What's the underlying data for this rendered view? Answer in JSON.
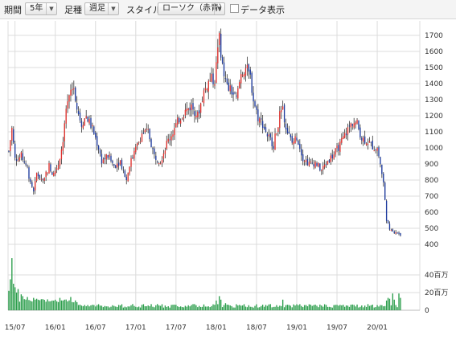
{
  "toolbar": {
    "period_label": "期間",
    "period_value": "5年",
    "interval_label": "足種",
    "interval_value": "週足",
    "style_label": "スタイル",
    "style_value": "ローソク（赤青）",
    "data_toggle_label": "データ表示"
  },
  "colors": {
    "up_candle": "#e0302c",
    "down_candle": "#1d3a9e",
    "volume": "#2a9d4a",
    "grid": "#dcdcdc",
    "wick": "#333333"
  },
  "chart_data": {
    "type": "candlestick",
    "title": "",
    "ylim": [
      350,
      1750
    ],
    "yticks": [
      1700,
      1600,
      1500,
      1400,
      1300,
      1200,
      1100,
      1000,
      900,
      800,
      700,
      600,
      500,
      400
    ],
    "xtick_labels": [
      "15/07",
      "16/01",
      "16/07",
      "17/01",
      "17/07",
      "18/01",
      "18/07",
      "19/01",
      "19/07",
      "20/01"
    ],
    "x_range_weeks": 266,
    "xtick_weeks": [
      4,
      30,
      56,
      82,
      108,
      134,
      160,
      186,
      212,
      238
    ],
    "price_anchors": [
      [
        0,
        980
      ],
      [
        2,
        1120
      ],
      [
        4,
        930
      ],
      [
        8,
        950
      ],
      [
        12,
        880
      ],
      [
        14,
        770
      ],
      [
        16,
        720
      ],
      [
        18,
        840
      ],
      [
        22,
        800
      ],
      [
        26,
        890
      ],
      [
        28,
        820
      ],
      [
        32,
        900
      ],
      [
        35,
        1040
      ],
      [
        37,
        1220
      ],
      [
        40,
        1350
      ],
      [
        42,
        1380
      ],
      [
        44,
        1250
      ],
      [
        47,
        1150
      ],
      [
        50,
        1200
      ],
      [
        54,
        1120
      ],
      [
        58,
        1000
      ],
      [
        60,
        920
      ],
      [
        64,
        950
      ],
      [
        68,
        890
      ],
      [
        72,
        920
      ],
      [
        76,
        800
      ],
      [
        78,
        900
      ],
      [
        82,
        990
      ],
      [
        86,
        1090
      ],
      [
        90,
        1100
      ],
      [
        94,
        950
      ],
      [
        98,
        920
      ],
      [
        102,
        1030
      ],
      [
        106,
        1100
      ],
      [
        110,
        1180
      ],
      [
        114,
        1230
      ],
      [
        118,
        1260
      ],
      [
        122,
        1200
      ],
      [
        126,
        1350
      ],
      [
        130,
        1430
      ],
      [
        133,
        1420
      ],
      [
        136,
        1700
      ],
      [
        138,
        1500
      ],
      [
        141,
        1380
      ],
      [
        144,
        1350
      ],
      [
        147,
        1300
      ],
      [
        150,
        1460
      ],
      [
        153,
        1500
      ],
      [
        156,
        1440
      ],
      [
        158,
        1300
      ],
      [
        161,
        1190
      ],
      [
        164,
        1150
      ],
      [
        167,
        1080
      ],
      [
        171,
        1020
      ],
      [
        175,
        1200
      ],
      [
        177,
        1230
      ],
      [
        180,
        1100
      ],
      [
        183,
        1030
      ],
      [
        186,
        1070
      ],
      [
        190,
        940
      ],
      [
        194,
        900
      ],
      [
        198,
        910
      ],
      [
        202,
        860
      ],
      [
        206,
        920
      ],
      [
        210,
        960
      ],
      [
        214,
        1020
      ],
      [
        218,
        1100
      ],
      [
        222,
        1160
      ],
      [
        225,
        1150
      ],
      [
        228,
        1060
      ],
      [
        232,
        1040
      ],
      [
        236,
        1000
      ],
      [
        238,
        1000
      ],
      [
        240,
        900
      ],
      [
        242,
        780
      ],
      [
        244,
        560
      ],
      [
        246,
        480
      ],
      [
        250,
        480
      ],
      [
        253,
        460
      ]
    ],
    "volume": {
      "yticks": [
        "40百万",
        "20百万",
        "0"
      ],
      "ymax": 60,
      "spikes": [
        [
          0,
          22
        ],
        [
          1,
          35
        ],
        [
          2,
          59
        ],
        [
          3,
          30
        ],
        [
          4,
          26
        ],
        [
          5,
          20
        ],
        [
          6,
          24
        ],
        [
          8,
          18
        ],
        [
          9,
          16
        ],
        [
          12,
          15
        ],
        [
          16,
          14
        ],
        [
          18,
          13
        ],
        [
          28,
          11
        ],
        [
          33,
          14
        ],
        [
          36,
          12
        ],
        [
          38,
          10
        ],
        [
          40,
          15
        ],
        [
          42,
          9
        ],
        [
          80,
          7
        ],
        [
          134,
          11
        ],
        [
          136,
          16
        ],
        [
          137,
          12
        ],
        [
          140,
          8
        ],
        [
          177,
          12
        ],
        [
          244,
          11
        ],
        [
          245,
          14
        ],
        [
          246,
          13
        ],
        [
          248,
          19
        ],
        [
          249,
          12
        ],
        [
          252,
          19
        ],
        [
          253,
          14
        ]
      ]
    }
  }
}
